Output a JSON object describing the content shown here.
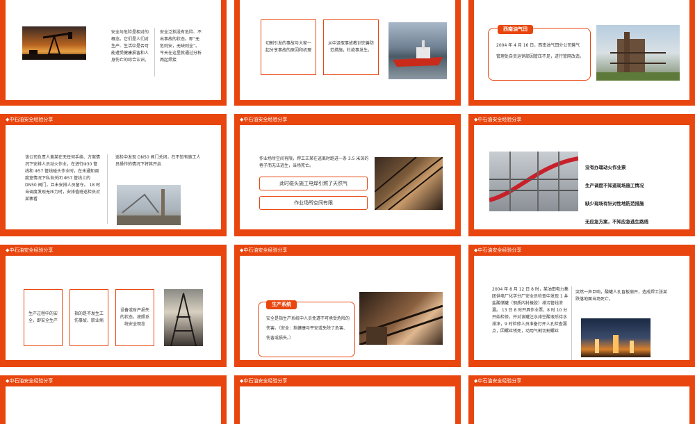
{
  "header_label": "◆中石油安全经验分享",
  "colors": {
    "accent": "#e8460e"
  },
  "s1": {
    "text_a": "安全与危险是相对的概念。它们是人们对生产、生活中是否可能遭受健康损害和人身伤亡的综合认识。",
    "text_b": "安全泛指没有危险、不出事故的状态。即“无危则安，无缺则全”。今天在这里就通过分析两起焊接"
  },
  "s2": {
    "box_a": "切割引发的事故与大家一起分享事故的原因和机理",
    "box_b": "从中汲取事故教训完善防范措施，杜绝事发生。"
  },
  "s3": {
    "tag": "西南油气田",
    "text": "2004 年 4 月 16 日，西南油气田分公司输气管理处自贡运销部因管压不足，进行管网改造。"
  },
  "s4": {
    "text_a": "该公司负责人黄某在无任何手续、方案情况下安排人员动火作业，在进行Φ30 管线和 Φ57 管线碰头作业时，在未通知调度室情况下私自关闭 Φ57 管线上的 DN50 阀门，且未安排人员留守。 18 时当调度发现无压力时，安排值班巡检员对某寨看",
    "text_b": "巡检中发现 DN50 阀门关闭，在不知有施工人员操作的情况下将其开启"
  },
  "s5": {
    "text": "作业场所空间有限，焊工王某在逃离时跑进一条 3.5 米深的巷子而无法逃生，当场死亡。",
    "box_a": "此时碰头施工电焊引燃了天然气",
    "box_b": "作业场所空间有限"
  },
  "s6": {
    "items": [
      "没有办理动火作业票",
      "生产调度不知道现场施工情况",
      "缺少现场有针对性地防范措施",
      "无应急方案，不知应急逃生路线"
    ]
  },
  "s7": {
    "boxes": [
      "生产过程中的安全，即安全生产",
      "指的是不发生工伤事故、职业病",
      "设备或财产损失的状态。按照系统安全观念"
    ]
  },
  "s8": {
    "tag": "生产系统",
    "text": "安全是指生产系统中人员免遭不可承受危险的伤害。（安全：指健康与平安或免除了危害、伤害或损失。）"
  },
  "s9": {
    "text_a": "2004 年 8 月 12 日 8 时，某油田电力集团供电厂化学分厂安全员检查中发现 1 井盐酸储罐（钢质内衬橡胶）排污管线泄漏。 13 日 8 时开具作业票，8 时 10 分开始检修，并对该罐注水排空酸液后待水排净，9 时检修人员准备打开人孔检查漏点，因螺丝锈死，动用气割切割螺丝",
    "text_b": "突然一声巨响，酸罐人孔盲板崩开，造成焊工张某跌落地面当场死亡。"
  }
}
